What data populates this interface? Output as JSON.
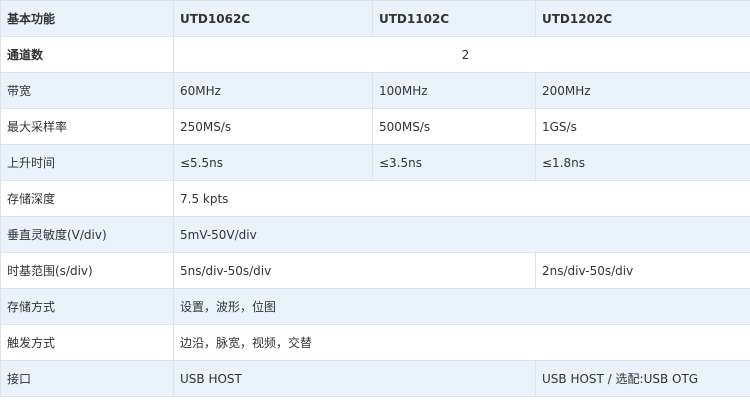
{
  "colors": {
    "row_tint": "#eaf3fb",
    "row_plain": "#ffffff",
    "border": "#e2e2e2",
    "text": "#333333"
  },
  "header": [
    "基本功能",
    "UTD1062C",
    "UTD1102C",
    "UTD1202C"
  ],
  "rows": [
    {
      "label": "通道数",
      "cells": [
        "2"
      ]
    },
    {
      "label": "带宽",
      "cells": [
        "60MHz",
        "100MHz",
        "200MHz"
      ]
    },
    {
      "label": "最大采样率",
      "cells": [
        "250MS/s",
        "500MS/s",
        "1GS/s"
      ]
    },
    {
      "label": "上升时间",
      "cells": [
        "≤5.5ns",
        "≤3.5ns",
        "≤1.8ns"
      ]
    },
    {
      "label": "存储深度",
      "cells": [
        "7.5 kpts"
      ]
    },
    {
      "label": "垂直灵敏度(V/div)",
      "cells": [
        "5mV-50V/div"
      ]
    },
    {
      "label": "时基范围(s/div)",
      "cells": [
        "5ns/div-50s/div",
        "2ns/div-50s/div"
      ]
    },
    {
      "label": "存储方式",
      "cells": [
        "设置，波形，位图"
      ]
    },
    {
      "label": "触发方式",
      "cells": [
        "边沿，脉宽，视频，交替"
      ]
    },
    {
      "label": "接口",
      "cells": [
        "USB HOST",
        "USB HOST / 选配:USB OTG"
      ]
    }
  ]
}
